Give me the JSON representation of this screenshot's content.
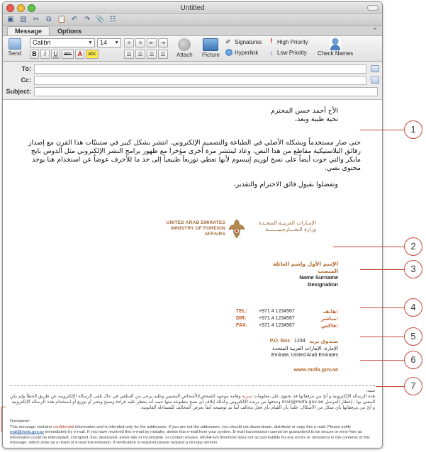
{
  "window": {
    "title": "Untitled"
  },
  "ribbon": {
    "tabs": [
      "Message",
      "Options"
    ],
    "send_label": "Send",
    "font": "Calibri",
    "size": "14",
    "attach_label": "Attach",
    "picture_label": "Picture",
    "signatures_label": "Signatures",
    "hyperlink_label": "Hyperlink",
    "high_priority_label": "High Priority",
    "low_priority_label": "Low Priority",
    "check_names_label": "Check Names"
  },
  "headers": {
    "to_label": "To:",
    "cc_label": "Cc:",
    "subject_label": "Subject:",
    "to_value": "",
    "cc_value": "",
    "subject_value": ""
  },
  "body": {
    "greeting_1": "الأخ أحمد حسن المحترم",
    "greeting_2": "تحية طيبة وبعد،",
    "paragraph": "حتى صار مستخدماً وبشكله الأصلي في الطباعة والتصميم الإلكتروني. انتشر بشكل كبير في ستينيّات هذا القرن مع إصدار رقائق البلاستيكية مقاطع من هذا النص، وعاد لينتشر مرة أخرى مؤخراَ مع ظهور برامج النشر الإلكتروني مثل ألدوس بايج مايكر والتي حوت أيضاً على نسخ لوريم إيبسوم لأنها تعطي توزيعاَ طبيعياَ إلى حد ما للأحرف عوضاً عن استخدام هنا يوجد محتوى نصي.",
    "closing": "وتفضلوا بقبول فائق الاحترام والتقدير،"
  },
  "logo": {
    "en_line_1": "UNITED ARAB EMIRATES",
    "en_line_2": "MINISTRY OF FOREIGN AFFAIRS",
    "ar_line_1": "الإمـارات العربيـة المتحـدة",
    "ar_line_2": "وزارة الـخـــارجـيـــــــة"
  },
  "signature": {
    "name_ar": "الإسم الأول وإسم العائلة",
    "title_ar": "المنصب",
    "name_en": "Name Surname",
    "title_en": "Designation"
  },
  "contact": [
    {
      "ar": "هاتف:",
      "num": "+971 4 1234567",
      "en": "TEL:"
    },
    {
      "ar": "مباشر:",
      "num": "+971 4 1234567",
      "en": "DIR:"
    },
    {
      "ar": "فاكس:",
      "num": "+971 4 1234567",
      "en": "FAX:"
    }
  ],
  "pobox": {
    "ar_label": "صندوق بريد",
    "num": "1234",
    "en_label": "P.O. Box",
    "addr_ar": "الإمارة، الإمارات العربية المتحدة",
    "addr_en": "Emirate, United Arab Emirates"
  },
  "website": "www.mofa.gov.ae",
  "disclaimer": {
    "ar_title": "تنبيه:",
    "ar_text_1": "هذه الرسالة الإلكترونية و أيٌ من مرفقاتها قد تحتوي على معلومات",
    "ar_highlight": "سرية",
    "ar_text_2": "وهامة موجهه للشخص/الأشخاص المعنيين وعليه يرجى من المتلقي في حال تلقى الرسالة الإلكترونية عن طريق الخطأ ولم يكن المعني بها ، إخطار المرسل mail@mofa.gov.ae وحذفها من بريده الإلكتروني وكذلك إتلاف أي نسخ مطبوعة منها حيث أنه يحظر عليه قراءة ونسخ ونشر أو توزيع أو استخدام هذه الرسالة الإلكترونية و أيٌ من مرفقاتها بأي شكل من الأشكال. علماً بأن القيام بأي فعل مخالف لما تم توضيحه آنفاً يعرض المخالف للمساءلة القانونية.",
    "en_title": "Disclaimer:",
    "en_text_1": "This message contains",
    "en_highlight": "confidential",
    "en_text_2": "information and is intended only for the addressee. If you are not the addressee, you should not disseminate, distribute or copy this e-mail. Please notify",
    "en_link": "mail@mofa.gov.ae",
    "en_text_3": "immediately by e-mail. If you have received this e-mail by mistake, delete this e-mail from your system. E-mail transmission cannot be guaranteed to be secure or error-free as information could be intercepted, corrupted, lost, destroyed, arrive late or incomplete, or contain viruses. MOFA-GS therefore does not accept liability for any errors or omissions in the contents of this message, which arise as a result of e-mail transmission. If verification is required please request a rd-copy version."
  },
  "callouts": [
    "1",
    "2",
    "3",
    "4",
    "5",
    "6",
    "7"
  ],
  "colors": {
    "accent_gold": "#b06c2f",
    "callout_red": "#c54a3c"
  }
}
